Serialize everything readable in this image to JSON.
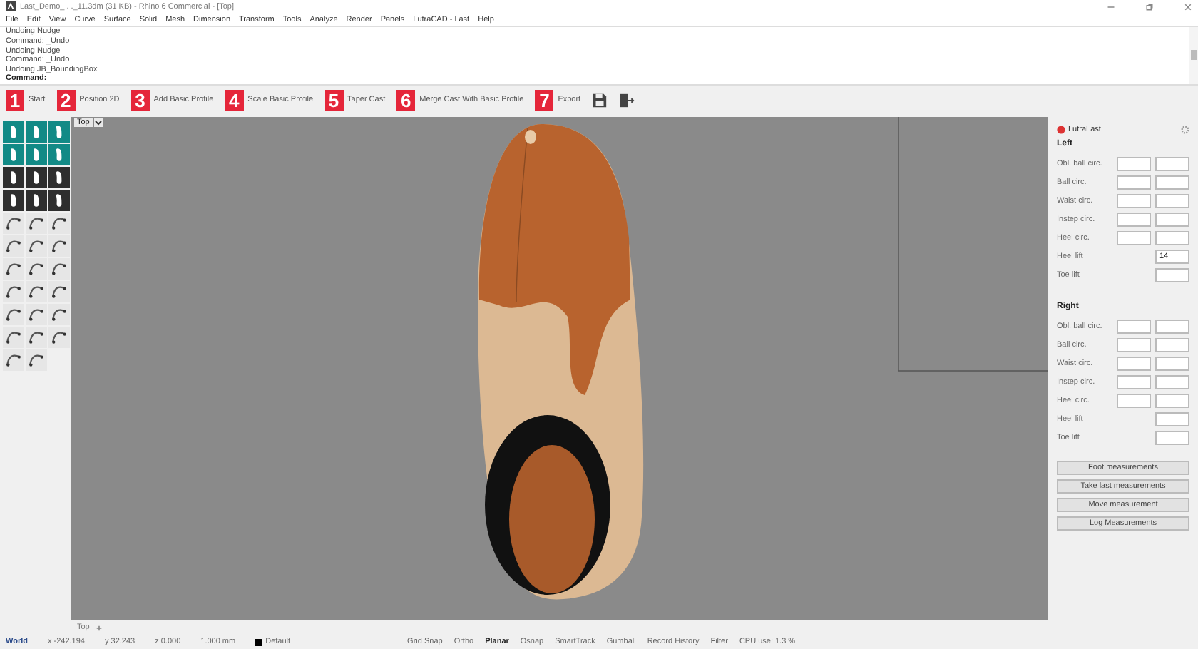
{
  "window": {
    "title": "Last_Demo_ . ._11.3dm (31 KB) - Rhino 6 Commercial - [Top]"
  },
  "menu": [
    "File",
    "Edit",
    "View",
    "Curve",
    "Surface",
    "Solid",
    "Mesh",
    "Dimension",
    "Transform",
    "Tools",
    "Analyze",
    "Render",
    "Panels",
    "LutraCAD - Last",
    "Help"
  ],
  "command_history": [
    {
      "text": "Undoing Nudge",
      "kind": "plain"
    },
    {
      "text": "Command: _Undo",
      "kind": "plain"
    },
    {
      "text": "Undoing Nudge",
      "kind": "plain"
    },
    {
      "text": "Command: _Undo",
      "kind": "plain"
    },
    {
      "text": "Undoing JB_BoundingBox",
      "kind": "plain"
    },
    {
      "text": "Command:",
      "kind": "prompt"
    }
  ],
  "steps": [
    {
      "number": "1",
      "label": "Start"
    },
    {
      "number": "2",
      "label": "Position 2D"
    },
    {
      "number": "3",
      "label": "Add Basic Profile"
    },
    {
      "number": "4",
      "label": "Scale Basic Profile"
    },
    {
      "number": "5",
      "label": "Taper Cast"
    },
    {
      "number": "6",
      "label": "Merge Cast With Basic Profile"
    },
    {
      "number": "7",
      "label": "Export"
    }
  ],
  "toolbar": [
    {
      "kind": "teal"
    },
    {
      "kind": "teal"
    },
    {
      "kind": "teal"
    },
    {
      "kind": "teal"
    },
    {
      "kind": "teal"
    },
    {
      "kind": "teal"
    },
    {
      "kind": "dark"
    },
    {
      "kind": "dark"
    },
    {
      "kind": "dark"
    },
    {
      "kind": "dark"
    },
    {
      "kind": "dark"
    },
    {
      "kind": "dark"
    },
    {
      "kind": "light"
    },
    {
      "kind": "light"
    },
    {
      "kind": "light"
    },
    {
      "kind": "light"
    },
    {
      "kind": "light"
    },
    {
      "kind": "light"
    },
    {
      "kind": "light"
    },
    {
      "kind": "light"
    },
    {
      "kind": "light"
    },
    {
      "kind": "light"
    },
    {
      "kind": "light"
    },
    {
      "kind": "light"
    },
    {
      "kind": "light"
    },
    {
      "kind": "light"
    },
    {
      "kind": "light"
    },
    {
      "kind": "light"
    },
    {
      "kind": "light"
    },
    {
      "kind": "light"
    },
    {
      "kind": "light"
    },
    {
      "kind": "light"
    }
  ],
  "viewport": {
    "title": "Top",
    "tab": "Top"
  },
  "panel": {
    "title": "LutraLast",
    "sections": [
      {
        "title": "Left",
        "rows": [
          {
            "label": "Obl. ball circ.",
            "kind": "pair"
          },
          {
            "label": "Ball circ.",
            "kind": "pair"
          },
          {
            "label": "Waist circ.",
            "kind": "pair"
          },
          {
            "label": "Instep circ.",
            "kind": "pair"
          },
          {
            "label": "Heel circ.",
            "kind": "pair"
          },
          {
            "label": "Heel lift",
            "kind": "single",
            "value": "14"
          },
          {
            "label": "Toe lift",
            "kind": "single"
          }
        ]
      },
      {
        "title": "Right",
        "rows": [
          {
            "label": "Obl. ball circ.",
            "kind": "pair"
          },
          {
            "label": "Ball circ.",
            "kind": "pair"
          },
          {
            "label": "Waist circ.",
            "kind": "pair"
          },
          {
            "label": "Instep circ.",
            "kind": "pair"
          },
          {
            "label": "Heel circ.",
            "kind": "pair"
          },
          {
            "label": "Heel lift",
            "kind": "single"
          },
          {
            "label": "Toe lift",
            "kind": "single"
          }
        ]
      }
    ],
    "buttons": [
      "Foot measurements",
      "Take last measurements",
      "Move measurement",
      "Log Measurements"
    ]
  },
  "status_bar": {
    "coords": [
      "World",
      "x -242.194",
      "y 32.243",
      "z 0.000",
      "1.000 mm"
    ],
    "layer": "Default",
    "toggles": [
      {
        "label": "Grid Snap",
        "on": false
      },
      {
        "label": "Ortho",
        "on": false
      },
      {
        "label": "Planar",
        "on": true
      },
      {
        "label": "Osnap",
        "on": false
      },
      {
        "label": "SmartTrack",
        "on": false
      },
      {
        "label": "Gumball",
        "on": false
      },
      {
        "label": "Record History",
        "on": false
      },
      {
        "label": "Filter",
        "on": false
      }
    ],
    "cpu": "CPU use: 1.3 %"
  }
}
